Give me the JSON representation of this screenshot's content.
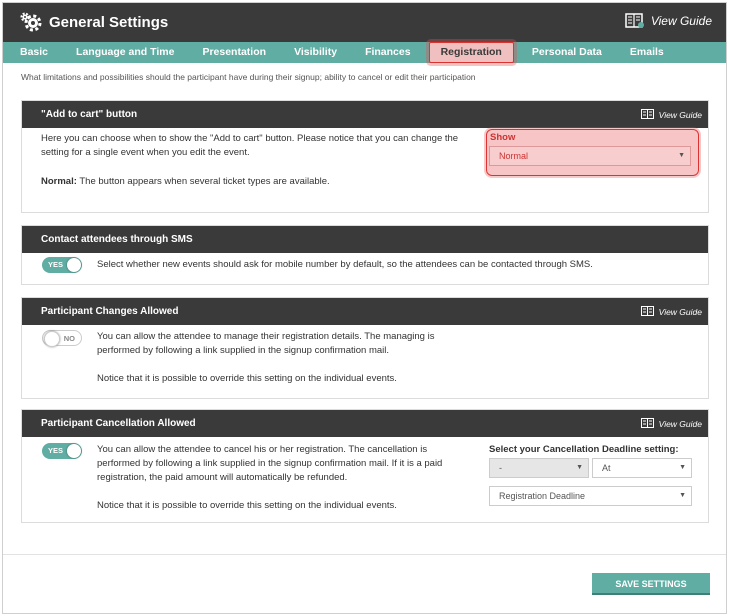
{
  "header": {
    "title": "General Settings",
    "view_guide": "View Guide"
  },
  "tabs": [
    {
      "label": "Basic"
    },
    {
      "label": "Language and Time"
    },
    {
      "label": "Presentation"
    },
    {
      "label": "Visibility"
    },
    {
      "label": "Finances"
    },
    {
      "label": "Registration",
      "active": true
    },
    {
      "label": "Personal Data"
    },
    {
      "label": "Emails"
    }
  ],
  "intro": "What limitations and possibilities should the participant have during their signup; ability to cancel or edit their participation",
  "panels": {
    "cart": {
      "title": "\"Add to cart\" button",
      "view_guide": "View Guide",
      "line1": "Here you can choose when to show the \"Add to cart\" button. Please notice that you can change the",
      "line2": "setting for a single event when you edit the event.",
      "normal_label": "Normal:",
      "normal_desc": "The button appears when several ticket types are available.",
      "show_label": "Show",
      "show_value": "Normal"
    },
    "sms": {
      "title": "Contact attendees through SMS",
      "toggle": "YES",
      "text": "Select whether new events should ask for mobile number by default, so the attendees can be contacted through SMS."
    },
    "changes": {
      "title": "Participant Changes Allowed",
      "view_guide": "View Guide",
      "toggle": "NO",
      "line1": "You can allow the attendee to manage their registration details. The managing is",
      "line2": "performed by following a link supplied in the signup confirmation mail.",
      "line3": "Notice that it is possible to override this setting on the individual events."
    },
    "cancel": {
      "title": "Participant Cancellation Allowed",
      "view_guide": "View Guide",
      "toggle": "YES",
      "line1": "You can allow the attendee to cancel his or her registration. The cancellation is",
      "line2": "performed by following a link supplied in the signup confirmation mail. If it is a paid",
      "line3": "registration, the paid amount will automatically be refunded.",
      "line4": "Notice that it is possible to override this setting on the individual events.",
      "deadline_label": "Select your Cancellation Deadline setting:",
      "select1": "-",
      "select2": "At",
      "select3": "Registration Deadline"
    }
  },
  "save_label": "SAVE SETTINGS",
  "colors": {
    "accent": "#5fada3",
    "dark": "#3a3a3a",
    "highlight": "#f0bfbf"
  }
}
